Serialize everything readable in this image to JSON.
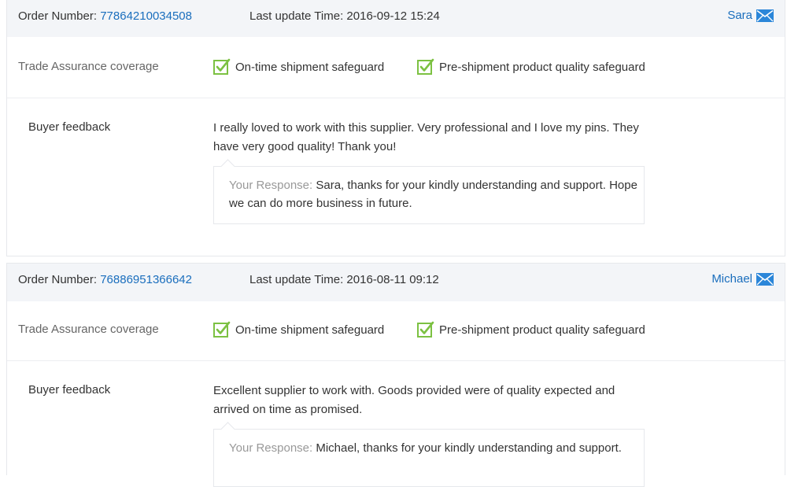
{
  "labels": {
    "order_number": "Order Number:",
    "last_update": "Last update Time:",
    "coverage": "Trade Assurance coverage",
    "feedback": "Buyer feedback",
    "your_response": "Your Response:"
  },
  "safeguards": [
    "On-time shipment safeguard",
    "Pre-shipment product quality safeguard"
  ],
  "colors": {
    "link": "#1a6ebd",
    "check": "#7cc142",
    "header_bg": "#f3f5f8"
  },
  "icons": {
    "mail": "mail-icon",
    "check": "check-icon"
  },
  "orders": [
    {
      "number": "77864210034508",
      "update_time": "2016-09-12 15:24",
      "buyer": "Sara",
      "feedback": "I really loved to work with this supplier. Very professional and I love my pins. They have very good quality! Thank you!",
      "response": "Sara, thanks for your kindly understanding and support. Hope we can do more business in future."
    },
    {
      "number": "76886951366642",
      "update_time": "2016-08-11 09:12",
      "buyer": "Michael",
      "feedback": "Excellent supplier to work with. Goods provided were of quality expected and arrived on time as promised.",
      "response": "Michael, thanks for your kindly understanding and support."
    }
  ]
}
